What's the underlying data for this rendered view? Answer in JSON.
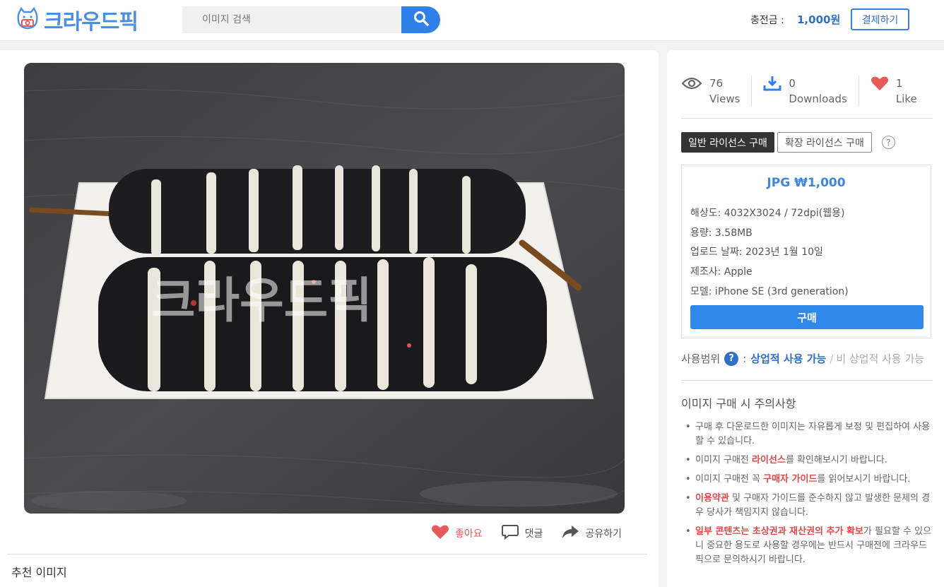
{
  "header": {
    "logo_text": "크라우드픽",
    "search_placeholder": "이미지 검색",
    "charge_label": "충전금 :",
    "charge_amount": "1,000원",
    "pay_button": "결제하기"
  },
  "image_actions": {
    "like": "좋아요",
    "comment": "댓글",
    "share": "공유하기"
  },
  "recommend_title": "추천 이미지",
  "stats": {
    "views_count": "76",
    "views_label": "Views",
    "downloads_count": "0",
    "downloads_label": "Downloads",
    "likes_count": "1",
    "likes_label": "Like"
  },
  "license": {
    "tab_standard": "일반 라이선스 구매",
    "tab_extended": "확장 라이선스 구매",
    "help": "?",
    "price_title": "JPG ₩1,000",
    "resolution": "해상도: 4032X3024 / 72dpi(웹용)",
    "size": "용량: 3.58MB",
    "upload_date": "업로드 날짜: 2023년 1월 10일",
    "maker": "제조사: Apple",
    "model": "모델: iPhone SE (3rd generation)",
    "buy_button": "구매"
  },
  "usage": {
    "label": "사용범위",
    "help": "?",
    "colon": ":",
    "commercial": "상업적 사용 가능",
    "slash": "/",
    "non_commercial": "비 상업적 사용 가능"
  },
  "notice": {
    "title": "이미지 구매 시 주의사항",
    "item1": "구매 후 다운로드한 이미지는 자유롭게 보정 및 편집하여 사용할 수 있습니다.",
    "item2_pre": "이미지 구매전 ",
    "item2_link": "라이선스",
    "item2_post": "를 확인해보시기 바랍니다.",
    "item3_pre": "이미지 구매전 꼭 ",
    "item3_link": "구매자 가이드",
    "item3_post": "를 읽어보시기 바랍니다.",
    "item4_link": "이용약관",
    "item4_post": " 및 구매자 가이드를 준수하지 않고 발생한 문제의 경우 당사가 책임지지 않습니다.",
    "item5_bold": "일부 콘텐츠는 초상권과 재산권의 추가 확보",
    "item5_post": "가 필요할 수 있으니 중요한 용도로 사용할 경우에는 반드시 구매전에 크라우드픽으로 문의하시기 바랍니다."
  },
  "photo": {
    "watermark": "크라우드픽"
  },
  "colors": {
    "accent": "#2f80e8",
    "like_red": "#e85a5a",
    "notice_red": "#e04848"
  }
}
